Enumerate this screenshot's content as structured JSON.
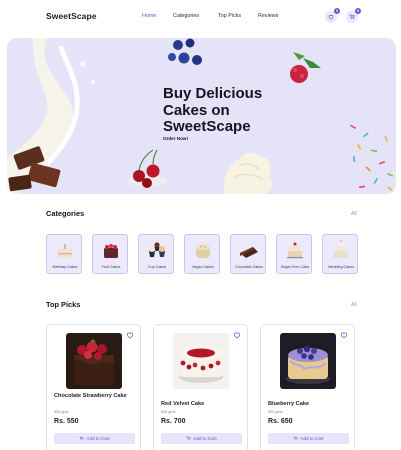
{
  "header": {
    "logo": "SweetScape",
    "nav": [
      "Home",
      "Categories",
      "Top Picks",
      "Reviews"
    ],
    "active_nav": "Home",
    "wishlist_count": "0",
    "cart_count": "0",
    "wishlist_icon": "heart-icon",
    "cart_icon": "cart-icon"
  },
  "hero": {
    "title": "Buy Delicious Cakes on SweetScape",
    "cta": "Order Now!",
    "background": "#e4e3f8"
  },
  "categories": {
    "title": "Categories",
    "see_all": "All",
    "items": [
      {
        "label": "Birthday Cakes"
      },
      {
        "label": "Fruit Cakes"
      },
      {
        "label": "Cup Cakes"
      },
      {
        "label": "Vegan Cakes"
      },
      {
        "label": "Chocolate Cakes"
      },
      {
        "label": "Sugar-Free Cake"
      },
      {
        "label": "Wedding Cakes"
      }
    ]
  },
  "top_picks": {
    "title": "Top Picks",
    "see_all": "All",
    "products": [
      {
        "name": "Chocolate Strawberry Cake",
        "weight": "500 gms",
        "price": "Rs. 550",
        "button": "Add to Cart"
      },
      {
        "name": "Red Velvet Cake",
        "weight": "500 gms",
        "price": "Rs. 700",
        "button": "Add to Cart"
      },
      {
        "name": "Blueberry Cake",
        "weight": "500 gms",
        "price": "Rs. 650",
        "button": "Add to Cart"
      }
    ]
  },
  "colors": {
    "accent": "#5b5bd6",
    "accent_light": "#e6e4fa",
    "text": "#1f1d2b"
  }
}
